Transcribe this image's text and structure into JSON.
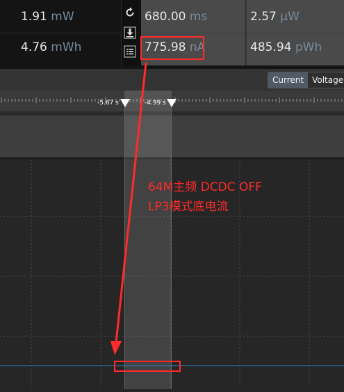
{
  "measurements": {
    "power_avg": {
      "value": "1.91",
      "unit": "mW"
    },
    "energy": {
      "value": "4.76",
      "unit": "mWh"
    },
    "window_time": {
      "value": "680.00",
      "unit": "ms"
    },
    "current_avg": {
      "value": "775.98",
      "unit": "nA"
    },
    "power_window": {
      "value": "2.57",
      "unit": "µW"
    },
    "energy_window": {
      "value": "485.94",
      "unit": "pWh"
    }
  },
  "icons": [
    "reset-icon",
    "download-icon",
    "list-icon"
  ],
  "tabs": {
    "current": "Current",
    "voltage": "Voltage"
  },
  "markers": {
    "left": "-5.67 s",
    "right": "-4.99 s"
  },
  "annotation": {
    "line1": "64M主频 DCDC OFF",
    "line2": "LP3模式底电流"
  },
  "colors": {
    "annotation": "#ff2b2b",
    "trace": "#2a8fc8",
    "unit": "#7a8a99"
  }
}
